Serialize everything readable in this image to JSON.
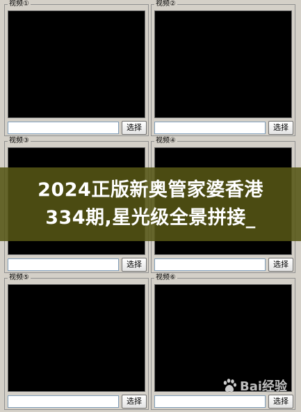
{
  "panels": [
    {
      "label": "视频①",
      "input_value": "",
      "button": "选择"
    },
    {
      "label": "视频②",
      "input_value": "",
      "button": "选择"
    },
    {
      "label": "视频③",
      "input_value": "",
      "button": "选择"
    },
    {
      "label": "视频④",
      "input_value": "",
      "button": "选择"
    },
    {
      "label": "视频⑤",
      "input_value": "",
      "button": "选择"
    },
    {
      "label": "视频⑥",
      "input_value": "",
      "button": "选择"
    }
  ],
  "banner": {
    "line1": "2024正版新奥管家婆香港",
    "line2": "334期,星光级全景拼接_"
  },
  "watermark": {
    "text": "Bai经验",
    "icon": "baidu-paw-icon"
  }
}
